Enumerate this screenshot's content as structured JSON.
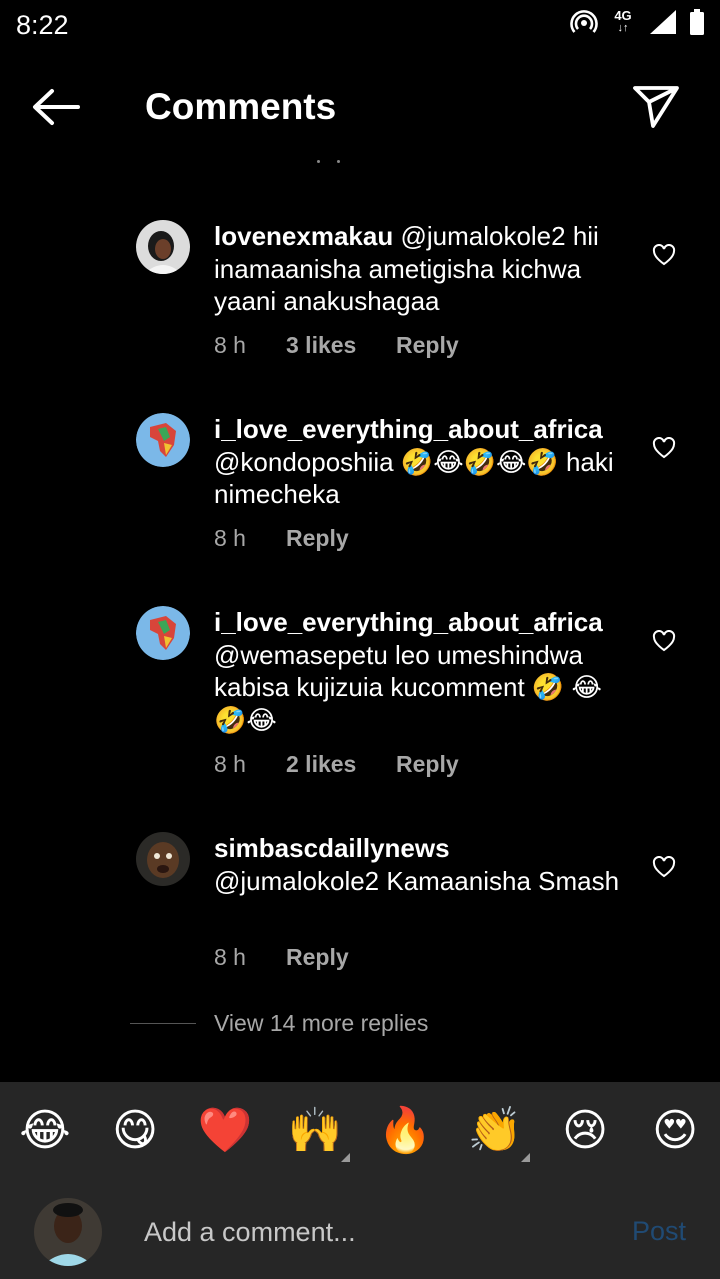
{
  "status_bar": {
    "time": "8:22",
    "network_top": "4G",
    "network_bottom": "↓↑"
  },
  "header": {
    "title": "Comments",
    "back_icon": "arrow-left-icon",
    "share_icon": "paper-plane-icon"
  },
  "comments": [
    {
      "username": "lovenexmakau",
      "text": "@jumalokole2 hii inamaanisha ametigisha kichwa yaani anakushagaa",
      "time": "8 h",
      "likes": "3 likes",
      "reply": "Reply"
    },
    {
      "username": "i_love_everything_about_africa",
      "text": "@kondoposhiia 🤣😂🤣😂🤣 haki nimecheka",
      "time": "8 h",
      "likes": "",
      "reply": "Reply"
    },
    {
      "username": "i_love_everything_about_africa",
      "text": "@wemasepetu leo umeshindwa kabisa kujizuia kucomment 🤣 😂🤣😂",
      "time": "8 h",
      "likes": "2 likes",
      "reply": "Reply"
    },
    {
      "username": "simbascdaillynews",
      "text": "@jumalokole2  Kamaanisha Smash",
      "time": "8 h",
      "likes": "",
      "reply": "Reply"
    }
  ],
  "view_more": "View 14 more replies",
  "emoji_bar": [
    "😂",
    "😋",
    "❤️",
    "🙌",
    "🔥",
    "👏",
    "😢",
    "😍"
  ],
  "composer": {
    "placeholder": "Add a comment...",
    "post_label": "Post"
  }
}
